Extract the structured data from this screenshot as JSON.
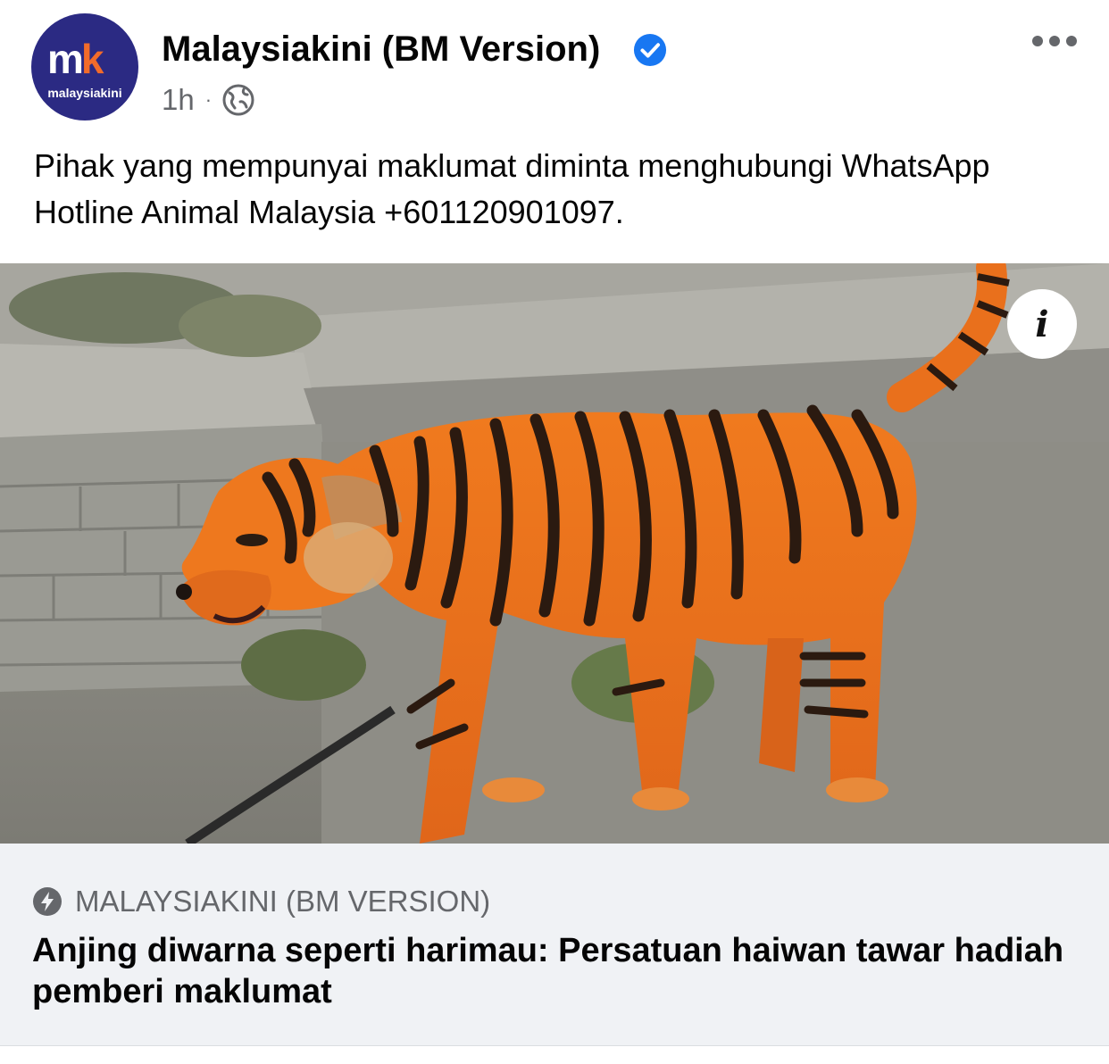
{
  "post": {
    "avatar": {
      "mark": "mk",
      "wordmark": "malaysiakini"
    },
    "page_name": "Malaysiakini (BM Version)",
    "verified_icon": "verified-badge-icon",
    "time": "1h",
    "separator": "·",
    "audience_icon": "globe-icon",
    "more_icon": "more-options-icon",
    "caption": "Pihak yang mempunyai maklumat diminta menghubungi WhatsApp Hotline Animal Malaysia +601120901097.",
    "info_label": "i"
  },
  "link_preview": {
    "source_icon": "instant-article-bolt-icon",
    "source": "MALAYSIAKINI (BM VERSION)",
    "headline": "Anjing diwarna seperti harimau: Persatuan haiwan tawar hadiah pemberi maklumat"
  },
  "colors": {
    "verified_blue": "#1877f2",
    "secondary_text": "#65676b",
    "avatar_bg": "#2b2a83",
    "avatar_accent": "#f26b2a",
    "preview_bg": "#f0f2f5"
  }
}
